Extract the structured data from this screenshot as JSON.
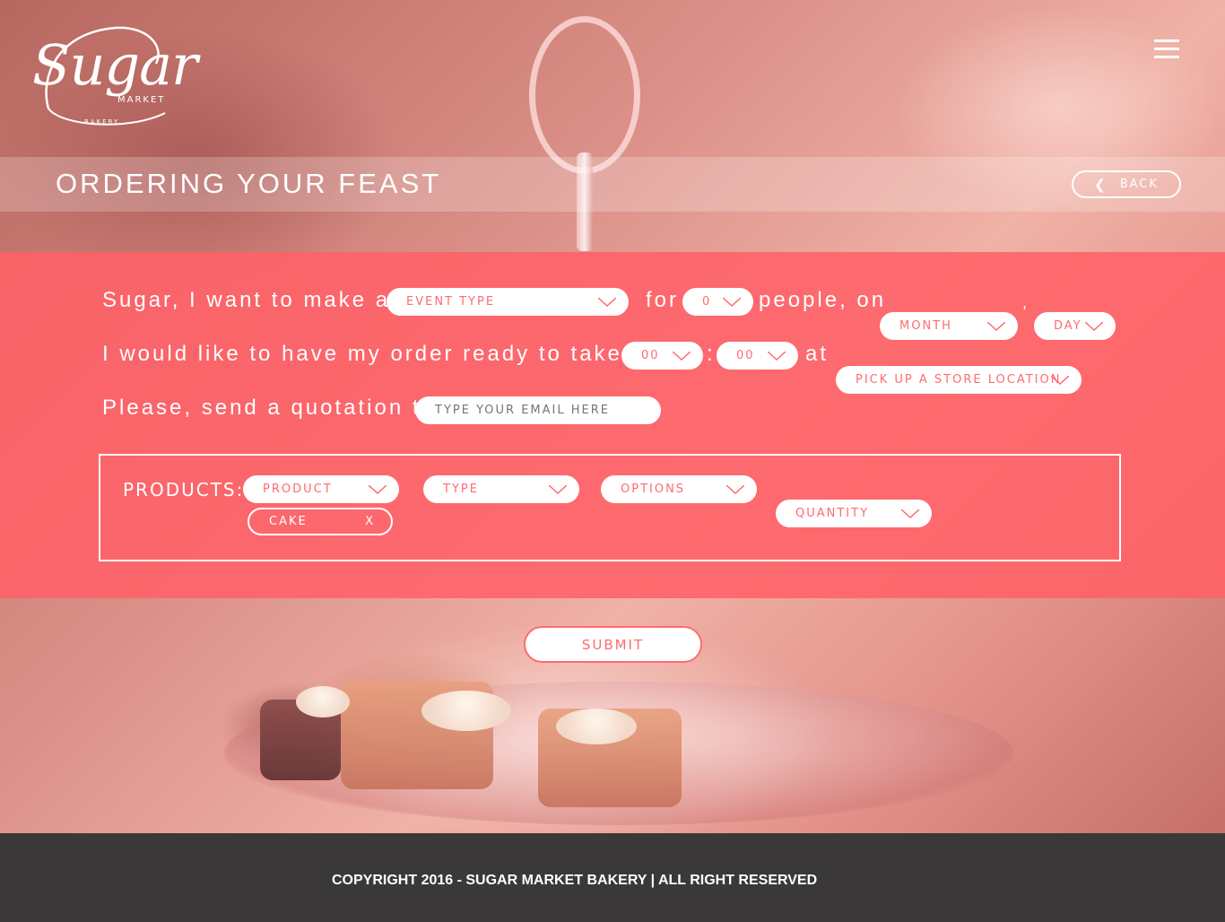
{
  "brand": {
    "logo_word": "Sugar",
    "logo_sub1": "MARKET",
    "logo_sub2": "BAKERY"
  },
  "header": {
    "menu_icon": "hamburger-menu-icon",
    "title": "ORDERING YOUR FEAST",
    "back_label": "BACK",
    "back_icon": "chevron-left-icon"
  },
  "form": {
    "line1_prefix": "Sugar, I want to make a",
    "event_type": "EVENT TYPE",
    "for_word": "for",
    "people_count": "0",
    "people_on": "people, on",
    "comma": ",",
    "month": "MONTH",
    "day": "DAY",
    "line2_prefix": "I would like to have my order ready to take at",
    "hour": "00",
    "colon": ":",
    "minute": "00",
    "at_word": "at",
    "store_location": "PICK UP A STORE LOCATION",
    "line3_prefix": "Please, send a quotation to",
    "email_placeholder": "TYPE YOUR EMAIL HERE"
  },
  "products": {
    "label": "PRODUCTS:",
    "product": "PRODUCT",
    "type": "TYPE",
    "options": "OPTIONS",
    "quantity": "QUANTITY",
    "selected_chip": "CAKE",
    "chip_remove": "X"
  },
  "submit_label": "SUBMIT",
  "footer": {
    "copyright": "COPYRIGHT 2016 - SUGAR MARKET BAKERY | ALL RIGHT RESERVED"
  },
  "colors": {
    "accent": "#ff6b70",
    "footer_bg": "#3a3838"
  }
}
